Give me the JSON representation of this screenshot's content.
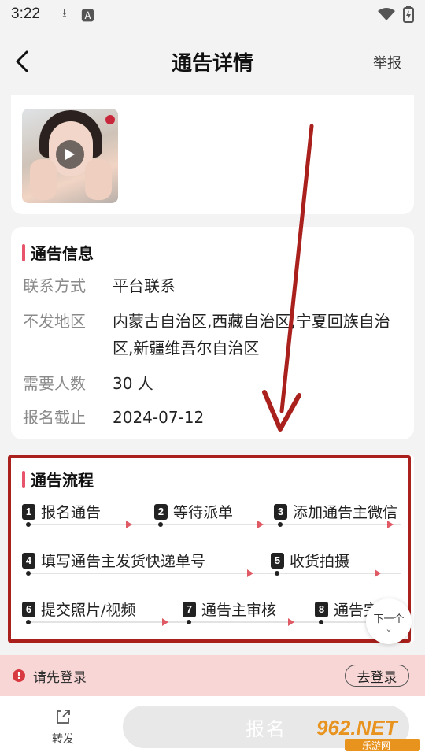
{
  "status_bar": {
    "time": "3:22"
  },
  "nav": {
    "title": "通告详情",
    "report_label": "举报"
  },
  "info": {
    "title": "通告信息",
    "rows": [
      {
        "label": "联系方式",
        "value": "平台联系"
      },
      {
        "label": "不发地区",
        "value": "内蒙古自治区,西藏自治区,宁夏回族自治区,新疆维吾尔自治区"
      },
      {
        "label": "需要人数",
        "value": "30 人"
      },
      {
        "label": "报名截止",
        "value": "2024-07-12"
      }
    ]
  },
  "flow": {
    "title": "通告流程",
    "steps": [
      {
        "num": "1",
        "label": "报名通告"
      },
      {
        "num": "2",
        "label": "等待派单"
      },
      {
        "num": "3",
        "label": "添加通告主微信"
      },
      {
        "num": "4",
        "label": "填写通告主发货快递单号"
      },
      {
        "num": "5",
        "label": "收货拍摄"
      },
      {
        "num": "6",
        "label": "提交照片/视频"
      },
      {
        "num": "7",
        "label": "通告主审核"
      },
      {
        "num": "8",
        "label": "通告完"
      }
    ],
    "next_label": "下一个"
  },
  "login": {
    "prompt": "请先登录",
    "button": "去登录"
  },
  "bottom": {
    "share_label": "转发",
    "signup_label": "报名"
  },
  "watermark": {
    "text": "962.NET",
    "subtext": "乐游网"
  },
  "colors": {
    "accent": "#e8546b",
    "annotation": "#a9201d",
    "login_bg": "#f9d6d6"
  }
}
